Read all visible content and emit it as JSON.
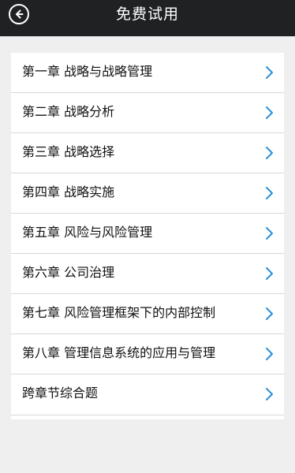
{
  "header": {
    "title": "免费试用",
    "back_icon": "back-arrow-icon"
  },
  "chapters": [
    {
      "label": "第一章 战略与战略管理"
    },
    {
      "label": "第二章 战略分析"
    },
    {
      "label": "第三章 战略选择"
    },
    {
      "label": "第四章 战略实施"
    },
    {
      "label": "第五章 风险与风险管理"
    },
    {
      "label": "第六章 公司治理"
    },
    {
      "label": "第七章 风险管理框架下的内部控制"
    },
    {
      "label": "第八章 管理信息系统的应用与管理"
    },
    {
      "label": "跨章节综合题"
    }
  ],
  "colors": {
    "topbar": "#1f2123",
    "chevron": "#2b8fd6",
    "background": "#efefef"
  }
}
